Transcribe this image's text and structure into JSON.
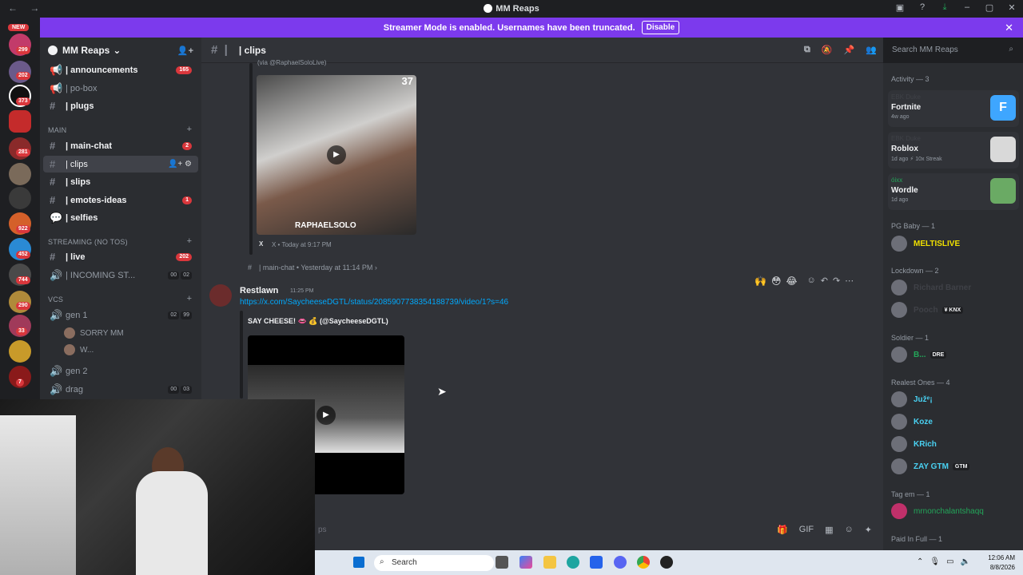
{
  "window": {
    "title": "MM Reaps",
    "nav_icons": "← →",
    "controls": [
      "▣",
      "?",
      "⤓",
      "–",
      "▢",
      "✕"
    ]
  },
  "banner": {
    "text": "Streamer Mode is enabled. Usernames have been truncated.",
    "disable_label": "Disable",
    "close": "✕"
  },
  "server_rail": {
    "new_label": "NEW",
    "badges": [
      "299",
      "202",
      "373",
      "281",
      "922",
      "452",
      "744",
      "290",
      "33",
      "7"
    ]
  },
  "sidebar": {
    "guild_name": "MM Reaps",
    "guild_chevron": "⌄",
    "channels_top": [
      {
        "label": "| announcements",
        "count": "165"
      },
      {
        "label": "| po-box",
        "count": ""
      },
      {
        "label": "| plugs",
        "count": ""
      }
    ],
    "main_category": "MAIN",
    "main_channels": [
      {
        "label": "| main-chat",
        "count": "2"
      },
      {
        "label": "| clips",
        "count": ""
      },
      {
        "label": "| slips",
        "count": ""
      },
      {
        "label": "| emotes-ideas",
        "count": "1"
      },
      {
        "label": "| selfies",
        "count": ""
      }
    ],
    "streaming_category": "STREAMING (NO TOS)",
    "streaming_channels": [
      {
        "label": "| live",
        "count": "202"
      },
      {
        "label": "| INCOMING ST...",
        "mini": [
          "00",
          "02"
        ]
      }
    ],
    "vc_category": "VCs",
    "voice_channels": [
      {
        "label": "gen 1",
        "mini": [
          "02",
          "99"
        ]
      },
      {
        "label": "gen 2"
      },
      {
        "label": "drag",
        "mini": [
          "00",
          "03"
        ]
      }
    ],
    "vc_users": [
      "SORRY MM",
      "W..."
    ]
  },
  "chat": {
    "channel": "| clips",
    "prev_embed_footer": "X • Today at 9:17 PM",
    "prev_embed_source": "X",
    "prev_embed_watermark": "RAPHAELSOLO",
    "prev_embed_header": "(via @RaphaelSoloLive)",
    "prev_embed_counter": "37",
    "forwarded_from": "| main-chat • Yesterday at 11:14 PM ›",
    "message": {
      "author": "Restlawn",
      "time": "11:25 PM",
      "link": "https://x.com/SaycheeseDGTL/status/2085907738354188739/video/1?s=46",
      "embed_title": "SAY CHEESE! 👄 💰 (@SaycheeseDGTL)"
    },
    "reactions": [
      "🙌",
      "😳",
      "😂"
    ],
    "hover_tools": [
      "☺",
      "↶",
      "↷",
      "⋯"
    ],
    "composer_placeholder": "ps"
  },
  "right": {
    "search_placeholder": "Search MM Reaps",
    "activity_header": "Activity — 3",
    "activities": [
      {
        "who": "EBK Duke",
        "game": "Fortnite",
        "ago": "4w ago",
        "color": "#3ea6ff"
      },
      {
        "who": "EBK Duke",
        "game": "Roblox",
        "ago": "1d ago  ⚡ 10x Streak",
        "color": "#d9d9d9"
      },
      {
        "who": "óixx",
        "game": "Wordle",
        "ago": "1d ago",
        "color": "#6aaa64"
      }
    ],
    "groups": [
      {
        "name": "PG Baby — 1",
        "members": [
          {
            "name": "MELTISLIVE",
            "color": "#f0e000"
          }
        ]
      },
      {
        "name": "Lockdown — 2",
        "members": [
          {
            "name": "Richard Barner",
            "color": "#3f4147"
          },
          {
            "name": "Pooch",
            "color": "#3f4147",
            "tag": "¥ KNX"
          }
        ]
      },
      {
        "name": "Soldier — 1",
        "members": [
          {
            "name": "B...",
            "color": "#23a559",
            "tag": "DRE"
          }
        ]
      },
      {
        "name": "Realest Ones — 4",
        "members": [
          {
            "name": "Južᵉ¡",
            "color": "#49d1f2"
          },
          {
            "name": "Koze",
            "color": "#49d1f2"
          },
          {
            "name": "KRich",
            "color": "#49d1f2"
          },
          {
            "name": "ZAY GTM",
            "color": "#49d1f2",
            "tag": "GTM"
          }
        ]
      },
      {
        "name": "Tag em — 1",
        "members": [
          {
            "name": "mrnonchalantshaqq",
            "color": "#23a559"
          }
        ]
      },
      {
        "name": "Paid In Full — 1",
        "members": []
      }
    ]
  },
  "taskbar": {
    "search_label": "Search",
    "time": "12:06 AM",
    "date": "8/8/2026"
  }
}
